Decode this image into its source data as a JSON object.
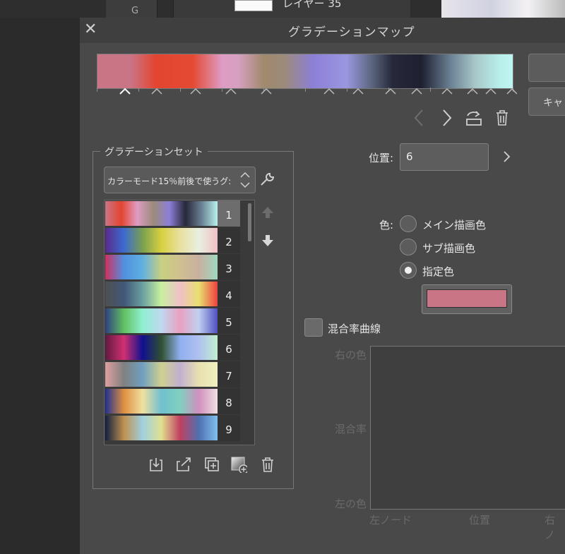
{
  "background": {
    "tab_letter": "G",
    "layer_name": "レイヤー 35"
  },
  "dialog": {
    "title": "グラデーションマップ",
    "close_icon": "close-icon",
    "right_buttons": [
      "",
      "キャ"
    ]
  },
  "gradient": {
    "selected_color": "#c97586"
  },
  "navigation": {
    "prev_icon": "chevron-left-icon",
    "next_icon": "chevron-right-icon",
    "flip_icon": "flip-gradient-icon",
    "delete_icon": "trash-icon"
  },
  "gradient_set": {
    "label": "グラデーションセット",
    "selected_set": "カラーモード15％前後で使うグ:",
    "settings_icon": "wrench-icon",
    "items": [
      {
        "number": "1",
        "colors": [
          "#c97586",
          "#e34530",
          "#de9cc4",
          "#9c8b7a",
          "#8c7fd8",
          "#27283a",
          "#6a8094",
          "#b8f0ec"
        ]
      },
      {
        "number": "2",
        "colors": [
          "#5a2a8a",
          "#3c6ad0",
          "#7aa050",
          "#d8d040",
          "#e8e0a0",
          "#e8f0e0",
          "#f0c0c8"
        ]
      },
      {
        "number": "3",
        "colors": [
          "#d03060",
          "#5090e0",
          "#60b0e0",
          "#c8d080",
          "#d0c090",
          "#c8b0a0",
          "#a0d8c0"
        ]
      },
      {
        "number": "4",
        "colors": [
          "#505050",
          "#405878",
          "#6aa0a0",
          "#c8f0a0",
          "#f0c0c8",
          "#e8e070",
          "#f04040"
        ]
      },
      {
        "number": "5",
        "colors": [
          "#304080",
          "#60c060",
          "#90f0d0",
          "#c0d8f0",
          "#e8a0c0",
          "#c0d0f0",
          "#5050c0"
        ]
      },
      {
        "number": "6",
        "colors": [
          "#601a40",
          "#d03070",
          "#101090",
          "#305030",
          "#90b0f0",
          "#b0c0f0",
          "#c0f0d0"
        ]
      },
      {
        "number": "7",
        "colors": [
          "#e0a0a0",
          "#808080",
          "#70a0c0",
          "#d0d090",
          "#c0b0d0",
          "#e8e0b0",
          "#f0f0c0"
        ]
      },
      {
        "number": "8",
        "colors": [
          "#203090",
          "#e09040",
          "#f0e0a0",
          "#70c0d0",
          "#80d0c0",
          "#d090c0",
          "#f0e0e0"
        ]
      },
      {
        "number": "9",
        "colors": [
          "#102040",
          "#c09050",
          "#a0d0e0",
          "#e0e090",
          "#c04060",
          "#5070b0",
          "#80c0f0"
        ]
      }
    ],
    "bottom_icons": [
      "import-icon",
      "export-icon",
      "duplicate-icon",
      "add-gradient-icon",
      "trash-icon"
    ]
  },
  "properties": {
    "position_label": "位置:",
    "position_value": "6",
    "color_label": "色:",
    "color_options": [
      "メイン描画色",
      "サブ描画色",
      "指定色"
    ],
    "selected_option": "指定色",
    "blend_curve_label": "混合率曲線",
    "curve_y_labels": [
      "右の色",
      "混合率",
      "左の色"
    ],
    "curve_x_labels": [
      "左ノード",
      "位置",
      "右ノ"
    ]
  }
}
